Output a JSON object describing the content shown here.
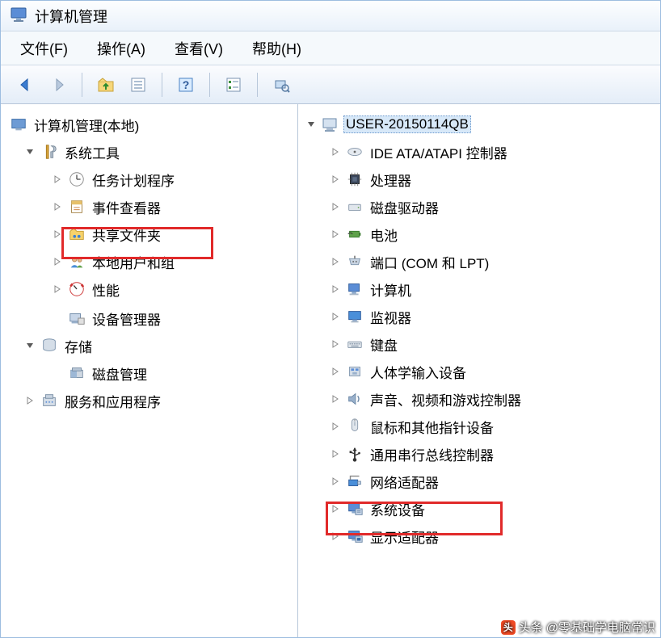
{
  "window": {
    "title": "计算机管理"
  },
  "menu": {
    "file": "文件(F)",
    "action": "操作(A)",
    "view": "查看(V)",
    "help": "帮助(H)"
  },
  "toolbar": {
    "back": "back",
    "forward": "forward",
    "up": "up-folder",
    "props": "properties",
    "help": "help",
    "list": "list-view",
    "refresh": "scan-hardware"
  },
  "leftTree": {
    "root": {
      "label": "计算机管理(本地)"
    },
    "systemTools": {
      "label": "系统工具",
      "children": {
        "taskScheduler": "任务计划程序",
        "eventViewer": "事件查看器",
        "sharedFolders": "共享文件夹",
        "localUsers": "本地用户和组",
        "performance": "性能",
        "deviceManager": "设备管理器"
      }
    },
    "storage": {
      "label": "存储",
      "children": {
        "diskMgmt": "磁盘管理"
      }
    },
    "services": {
      "label": "服务和应用程序"
    }
  },
  "deviceTree": {
    "root": "USER-20150114QB",
    "items": {
      "ide": "IDE ATA/ATAPI 控制器",
      "cpu": "处理器",
      "disk": "磁盘驱动器",
      "battery": "电池",
      "ports": "端口 (COM 和 LPT)",
      "computer": "计算机",
      "monitor": "监视器",
      "keyboard": "键盘",
      "hid": "人体学输入设备",
      "sound": "声音、视频和游戏控制器",
      "mouse": "鼠标和其他指针设备",
      "usb": "通用串行总线控制器",
      "network": "网络适配器",
      "system": "系统设备",
      "display": "显示适配器"
    }
  },
  "watermark": {
    "prefix": "头条",
    "text": "@零基础学电脑常识"
  }
}
